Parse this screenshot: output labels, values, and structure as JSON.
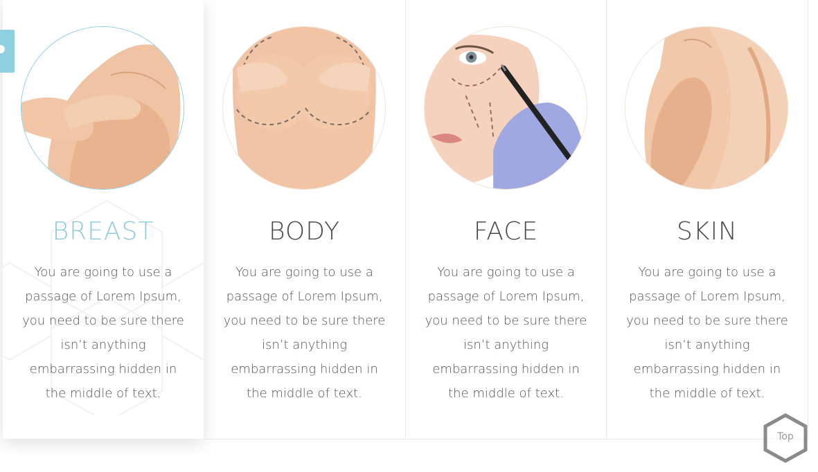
{
  "cards": [
    {
      "title": "BREAST",
      "description": "You are going to use a passage of Lorem Ipsum, you need to be sure there isn’t anything embarrassing hidden in the middle of text.",
      "image": "breast-photo",
      "active": true
    },
    {
      "title": "BODY",
      "description": "You are going to use a passage of Lorem Ipsum, you need to be sure there isn’t anything embarrassing hidden in the middle of text.",
      "image": "body-photo",
      "active": false
    },
    {
      "title": "FACE",
      "description": "You are going to use a passage of Lorem Ipsum, you need to be sure there isn’t anything embarrassing hidden in the middle of text.",
      "image": "face-photo",
      "active": false
    },
    {
      "title": "SKIN",
      "description": "You are going to use a passage of Lorem Ipsum, you need to be sure there isn’t anything embarrassing hidden in the middle of text.",
      "image": "skin-photo",
      "active": false
    }
  ],
  "scroll_top": {
    "label": "Top",
    "icon": "hexagon-icon"
  },
  "side_tab": {
    "icon": "settings-icon"
  },
  "colors": {
    "accent": "#8ecfe0",
    "title_text": "#4a4a4a",
    "body_text": "#555555",
    "skin": "#e8b896"
  }
}
